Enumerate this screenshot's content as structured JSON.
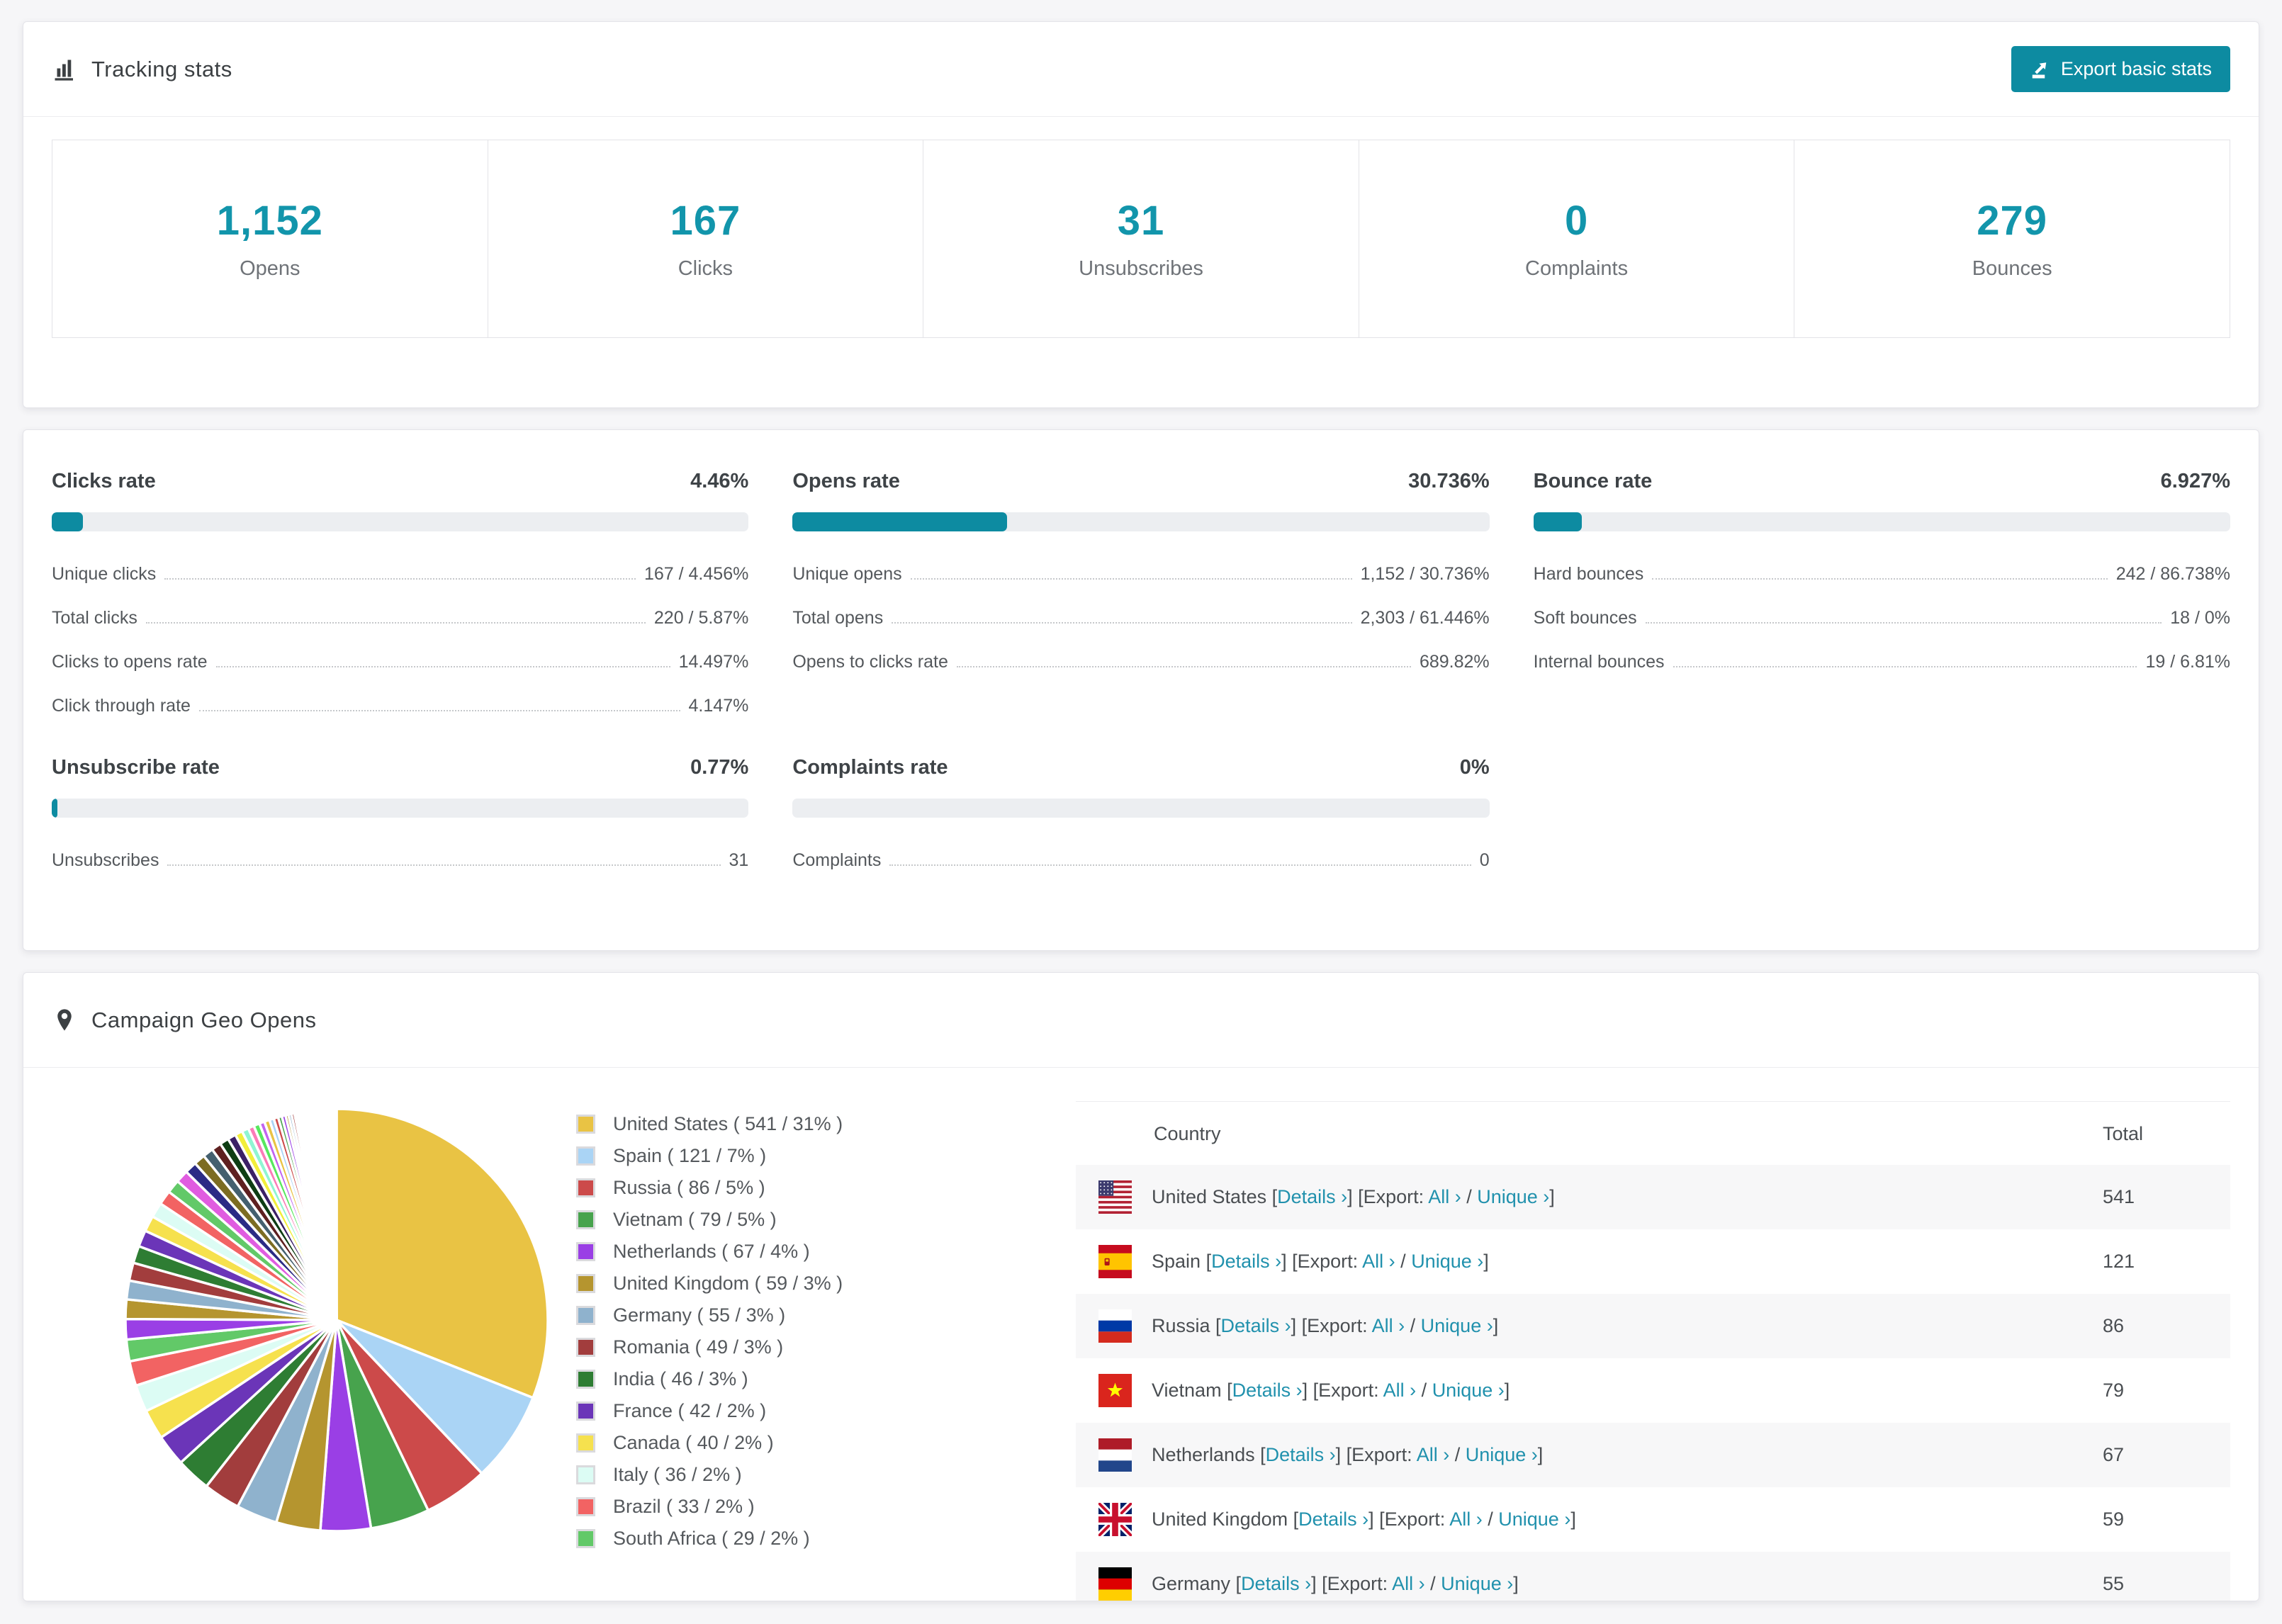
{
  "colors": {
    "accent": "#0d8ba1",
    "link": "#2191ad",
    "stat_number": "#1295ab"
  },
  "tracking": {
    "title": "Tracking stats",
    "export_button": "Export basic stats",
    "stats": [
      {
        "value": "1,152",
        "label": "Opens"
      },
      {
        "value": "167",
        "label": "Clicks"
      },
      {
        "value": "31",
        "label": "Unsubscribes"
      },
      {
        "value": "0",
        "label": "Complaints"
      },
      {
        "value": "279",
        "label": "Bounces"
      }
    ]
  },
  "rates": [
    {
      "title": "Clicks rate",
      "value": "4.46%",
      "percent": 4.46,
      "rows": [
        [
          "Unique clicks",
          "167 / 4.456%"
        ],
        [
          "Total clicks",
          "220 / 5.87%"
        ],
        [
          "Clicks to opens rate",
          "14.497%"
        ],
        [
          "Click through rate",
          "4.147%"
        ]
      ]
    },
    {
      "title": "Opens rate",
      "value": "30.736%",
      "percent": 30.736,
      "rows": [
        [
          "Unique opens",
          "1,152 / 30.736%"
        ],
        [
          "Total opens",
          "2,303 / 61.446%"
        ],
        [
          "Opens to clicks rate",
          "689.82%"
        ]
      ]
    },
    {
      "title": "Bounce rate",
      "value": "6.927%",
      "percent": 6.927,
      "rows": [
        [
          "Hard bounces",
          "242 / 86.738%"
        ],
        [
          "Soft bounces",
          "18 / 0%"
        ],
        [
          "Internal bounces",
          "19 / 6.81%"
        ]
      ]
    },
    {
      "title": "Unsubscribe rate",
      "value": "0.77%",
      "percent": 0.77,
      "rows": [
        [
          "Unsubscribes",
          "31"
        ]
      ]
    },
    {
      "title": "Complaints rate",
      "value": "0%",
      "percent": 0,
      "rows": [
        [
          "Complaints",
          "0"
        ]
      ]
    }
  ],
  "geo": {
    "title": "Campaign Geo Opens",
    "chart_data": {
      "type": "pie",
      "title": "Campaign Geo Opens",
      "legend_position": "right",
      "slices": [
        {
          "label": "United States",
          "value": 541,
          "pct": 31,
          "color": "#e9c344"
        },
        {
          "label": "Spain",
          "value": 121,
          "pct": 7,
          "color": "#aad4f5"
        },
        {
          "label": "Russia",
          "value": 86,
          "pct": 5,
          "color": "#cc4a4a"
        },
        {
          "label": "Vietnam",
          "value": 79,
          "pct": 5,
          "color": "#47a34d"
        },
        {
          "label": "Netherlands",
          "value": 67,
          "pct": 4,
          "color": "#9a3fe5"
        },
        {
          "label": "United Kingdom",
          "value": 59,
          "pct": 3,
          "color": "#b5952f"
        },
        {
          "label": "Germany",
          "value": 55,
          "pct": 3,
          "color": "#8fb2cd"
        },
        {
          "label": "Romania",
          "value": 49,
          "pct": 3,
          "color": "#a23d3d"
        },
        {
          "label": "India",
          "value": 46,
          "pct": 3,
          "color": "#2e7d33"
        },
        {
          "label": "France",
          "value": 42,
          "pct": 2,
          "color": "#6b35b8"
        },
        {
          "label": "Canada",
          "value": 40,
          "pct": 2,
          "color": "#f6e14e"
        },
        {
          "label": "Italy",
          "value": 36,
          "pct": 2,
          "color": "#dcfcf4"
        },
        {
          "label": "Brazil",
          "value": 33,
          "pct": 2,
          "color": "#f26363"
        },
        {
          "label": "South Africa",
          "value": 29,
          "pct": 2,
          "color": "#62c968"
        }
      ],
      "others": {
        "values": [
          27,
          26,
          25,
          24,
          23,
          22,
          21,
          20,
          19,
          18,
          17,
          16,
          15,
          14,
          13,
          12,
          11,
          10,
          9,
          8,
          8,
          7,
          7,
          6,
          6,
          5,
          5,
          4,
          4,
          4,
          3,
          3,
          3,
          3,
          2,
          2,
          2,
          2,
          2,
          2,
          2,
          2,
          2,
          2,
          2,
          2,
          1,
          1,
          1,
          1,
          1,
          1,
          1,
          1,
          1,
          1,
          1,
          1,
          1,
          1,
          1,
          1,
          1,
          1,
          1,
          1
        ],
        "palette": [
          "#9a3fe5",
          "#b5952f",
          "#8fb2cd",
          "#a23d3d",
          "#2e7d33",
          "#6b35b8",
          "#f6e14e",
          "#dcfcf4",
          "#f26363",
          "#62c968",
          "#e05ce0",
          "#2b2b85",
          "#7c6c22",
          "#44606f",
          "#5e2020",
          "#0e3d13",
          "#3b2066",
          "#f2ee3a",
          "#8ff5d2",
          "#fb7bb8",
          "#57e85e",
          "#c163f0",
          "#e9c344",
          "#aad4f5",
          "#cc4a4a",
          "#47a34d"
        ]
      }
    },
    "legend_items": [
      "United States ( 541 / 31% )",
      "Spain ( 121 / 7% )",
      "Russia ( 86 / 5% )",
      "Vietnam ( 79 / 5% )",
      "Netherlands ( 67 / 4% )",
      "United Kingdom ( 59 / 3% )",
      "Germany ( 55 / 3% )",
      "Romania ( 49 / 3% )",
      "India ( 46 / 3% )",
      "France ( 42 / 2% )",
      "Canada ( 40 / 2% )",
      "Italy ( 36 / 2% )",
      "Brazil ( 33 / 2% )",
      "South Africa ( 29 / 2% )"
    ],
    "table": {
      "headers": [
        "Country",
        "Total"
      ],
      "link_labels": {
        "details": "Details ›",
        "export": "Export:",
        "all": "All ›",
        "separator": "/",
        "unique": "Unique ›"
      },
      "rows": [
        {
          "flag": "us",
          "country": "United States",
          "total": "541"
        },
        {
          "flag": "es",
          "country": "Spain",
          "total": "121"
        },
        {
          "flag": "ru",
          "country": "Russia",
          "total": "86"
        },
        {
          "flag": "vn",
          "country": "Vietnam",
          "total": "79"
        },
        {
          "flag": "nl",
          "country": "Netherlands",
          "total": "67"
        },
        {
          "flag": "gb",
          "country": "United Kingdom",
          "total": "59"
        },
        {
          "flag": "de",
          "country": "Germany",
          "total": "55"
        }
      ]
    }
  }
}
